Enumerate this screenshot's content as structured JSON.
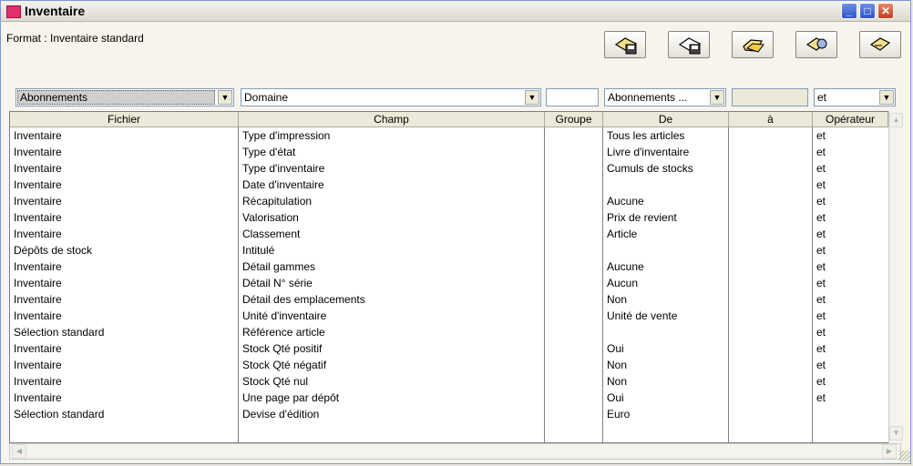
{
  "window": {
    "title": "Inventaire"
  },
  "format": {
    "label": "Format : Inventaire standard"
  },
  "toolbar": {
    "buttons": [
      {
        "icon": "save-selection-icon"
      },
      {
        "icon": "save-as-icon"
      },
      {
        "icon": "open-folder-icon"
      },
      {
        "icon": "options-icon"
      },
      {
        "icon": "edit-icon"
      }
    ]
  },
  "filters": {
    "fichier": "Abonnements",
    "champ": "Domaine",
    "groupe": "",
    "de": "Abonnements ...",
    "a": "",
    "operateur": "et"
  },
  "table": {
    "headers": [
      "Fichier",
      "Champ",
      "Groupe",
      "De",
      "à",
      "Opérateur"
    ],
    "rows": [
      [
        "Inventaire",
        "Type d'impression",
        "",
        "Tous les articles",
        "",
        "et"
      ],
      [
        "Inventaire",
        "Type d'état",
        "",
        "Livre d'inventaire",
        "",
        "et"
      ],
      [
        "Inventaire",
        "Type d'inventaire",
        "",
        "Cumuls de stocks",
        "",
        "et"
      ],
      [
        "Inventaire",
        "Date d'inventaire",
        "",
        "",
        "",
        "et"
      ],
      [
        "Inventaire",
        "Récapitulation",
        "",
        "Aucune",
        "",
        "et"
      ],
      [
        "Inventaire",
        "Valorisation",
        "",
        "Prix de revient",
        "",
        "et"
      ],
      [
        "Inventaire",
        "Classement",
        "",
        "Article",
        "",
        "et"
      ],
      [
        "Dépôts de stock",
        "Intitulé",
        "",
        "",
        "",
        "et"
      ],
      [
        "Inventaire",
        "Détail gammes",
        "",
        "Aucune",
        "",
        "et"
      ],
      [
        "Inventaire",
        "Détail N° série",
        "",
        "Aucun",
        "",
        "et"
      ],
      [
        "Inventaire",
        "Détail des emplacements",
        "",
        "Non",
        "",
        "et"
      ],
      [
        "Inventaire",
        "Unité d'inventaire",
        "",
        "Unité de vente",
        "",
        "et"
      ],
      [
        "Sélection standard",
        "Référence article",
        "",
        "",
        "",
        "et"
      ],
      [
        "Inventaire",
        "Stock Qté positif",
        "",
        "Oui",
        "",
        "et"
      ],
      [
        "Inventaire",
        "Stock Qté négatif",
        "",
        "Non",
        "",
        "et"
      ],
      [
        "Inventaire",
        "Stock Qté nul",
        "",
        "Non",
        "",
        "et"
      ],
      [
        "Inventaire",
        "Une page par dépôt",
        "",
        "Oui",
        "",
        "et"
      ],
      [
        "Sélection standard",
        "Devise d'édition",
        "",
        "Euro",
        "",
        ""
      ]
    ]
  }
}
